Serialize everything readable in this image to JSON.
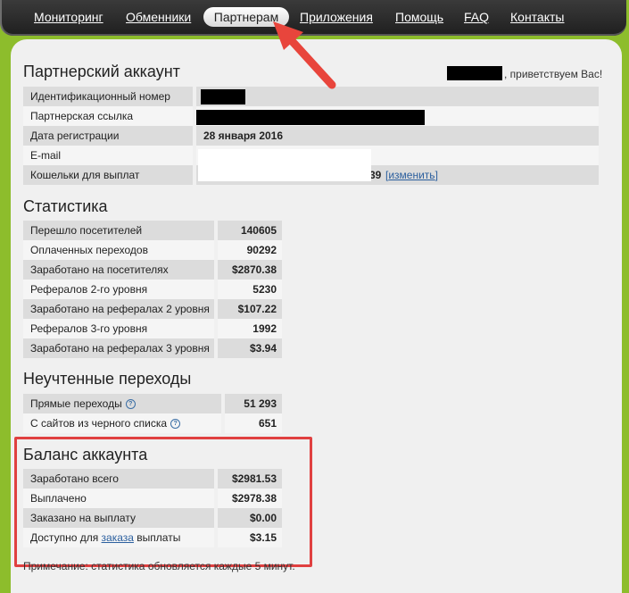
{
  "nav": {
    "items": [
      {
        "label": "Мониторинг"
      },
      {
        "label": "Обменники"
      },
      {
        "label": "Партнерам"
      },
      {
        "label": "Приложения"
      },
      {
        "label": "Помощь"
      },
      {
        "label": "FAQ"
      },
      {
        "label": "Контакты"
      }
    ],
    "active": "Партнерам"
  },
  "account": {
    "title": "Партнерский аккаунт",
    "greeting": ", приветствуем Вас!",
    "rows": [
      {
        "label": "Идентификационный номер",
        "value": ""
      },
      {
        "label": "Партнерская ссылка",
        "value": ""
      },
      {
        "label": "Дата регистрации",
        "value": "28 января 2016"
      },
      {
        "label": "E-mail",
        "value": ""
      },
      {
        "label": "Кошельки для выплат",
        "value": "39",
        "action": "изменить"
      }
    ]
  },
  "stats": {
    "title": "Статистика",
    "rows": [
      {
        "label": "Перешло посетителей",
        "value": "140605"
      },
      {
        "label": "Оплаченных переходов",
        "value": "90292"
      },
      {
        "label": "Заработано на посетителях",
        "value": "$2870.38"
      },
      {
        "label": "Рефералов 2-го уровня",
        "value": "5230"
      },
      {
        "label": "Заработано на рефералах 2 уровня",
        "value": "$107.22"
      },
      {
        "label": "Рефералов 3-го уровня",
        "value": "1992"
      },
      {
        "label": "Заработано на рефералах 3 уровня",
        "value": "$3.94"
      }
    ]
  },
  "uncounted": {
    "title": "Неучтенные переходы",
    "rows": [
      {
        "label": "Прямые переходы",
        "value": "51 293"
      },
      {
        "label": "С сайтов из черного списка",
        "value": "651"
      }
    ]
  },
  "balance": {
    "title": "Баланс аккаунта",
    "rows": [
      {
        "label": "Заработано всего",
        "value": "$2981.53"
      },
      {
        "label": "Выплачено",
        "value": "$2978.38"
      },
      {
        "label": "Заказано на выплату",
        "value": "$0.00"
      },
      {
        "label_prefix": "Доступно для ",
        "label_link": "заказа",
        "label_suffix": " выплаты",
        "value": "$3.15"
      }
    ]
  },
  "note": "Примечание: статистика обновляется каждые 5 минут.",
  "colors": {
    "accent": "#8dbd2c",
    "annotation": "#e04040"
  }
}
